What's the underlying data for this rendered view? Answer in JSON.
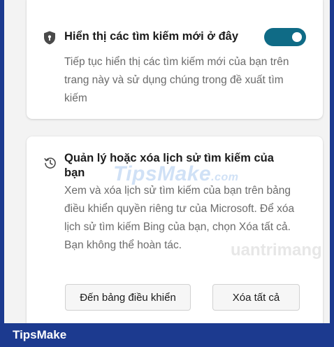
{
  "card_history_toggle": {
    "title": "Hiển thị các tìm kiếm mới ở đây",
    "description": "Tiếp tục hiển thị các tìm kiếm mới của bạn trên trang này và sử dụng chúng trong đề xuất tìm kiếm",
    "icon": "shield-icon",
    "toggle_on": true,
    "toggle_color": "#0f6b86"
  },
  "card_manage_history": {
    "title": "Quản lý hoặc xóa lịch sử tìm kiếm của bạn",
    "description": "Xem và xóa lịch sử tìm kiếm của bạn trên bảng điều khiển quyền riêng tư của Microsoft. Để xóa lịch sử tìm kiếm Bing của bạn, chọn Xóa tất cả. Bạn không thể hoàn tác.",
    "icon": "history-icon",
    "dashboard_button": "Đến bảng điều khiển",
    "clear_all_button": "Xóa tất cả"
  },
  "watermark": {
    "main": "TipsMake",
    "domain": ".com",
    "secondary": "uantrimang"
  },
  "footer": {
    "brand": "TipsMake",
    "color": "#1c3a8f"
  }
}
